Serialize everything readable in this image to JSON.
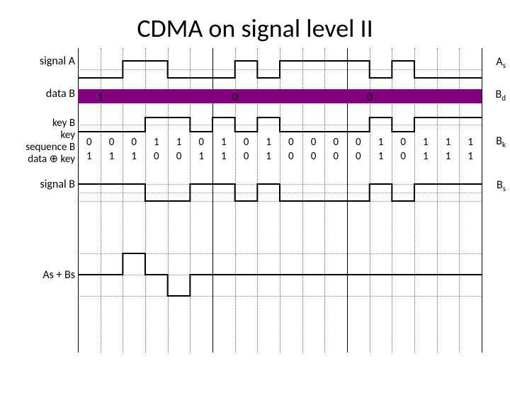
{
  "title": "CDMA on signal level II",
  "labels": {
    "signal_a": "signal A",
    "data_b": "data B",
    "key_b_1": "key B",
    "key_b_2": "key",
    "key_b_3": "sequence B",
    "key_b_4": "data ⊕ key",
    "signal_b": "signal B",
    "sum": "As + Bs",
    "As": "A",
    "As_sub": "s",
    "Bd": "B",
    "Bd_sub": "d",
    "Bk": "B",
    "Bk_sub": "k",
    "Bs": "B",
    "Bs_sub": "s"
  },
  "chart_data": {
    "type": "line",
    "chips": 18,
    "major_every": 6,
    "signal_a_levels": [
      -1,
      -1,
      1,
      1,
      -1,
      -1,
      -1,
      1,
      -1,
      1,
      1,
      1,
      1,
      -1,
      1,
      -1,
      -1,
      -1
    ],
    "data_b_bits": [
      1,
      0,
      0
    ],
    "key_sequence_b": [
      0,
      0,
      0,
      1,
      1,
      0,
      1,
      0,
      1,
      0,
      0,
      0,
      0,
      1,
      0,
      1,
      1,
      1
    ],
    "data_xor_key": [
      1,
      1,
      1,
      0,
      0,
      1,
      1,
      0,
      1,
      0,
      0,
      0,
      0,
      1,
      0,
      1,
      1,
      1
    ],
    "signal_b_levels": [
      1,
      1,
      1,
      -1,
      -1,
      1,
      1,
      -1,
      1,
      -1,
      -1,
      -1,
      -1,
      1,
      -1,
      1,
      1,
      1
    ],
    "sum_levels": [
      0,
      0,
      2,
      0,
      -2,
      0,
      0,
      0,
      0,
      0,
      0,
      0,
      0,
      0,
      0,
      0,
      0,
      0
    ]
  }
}
